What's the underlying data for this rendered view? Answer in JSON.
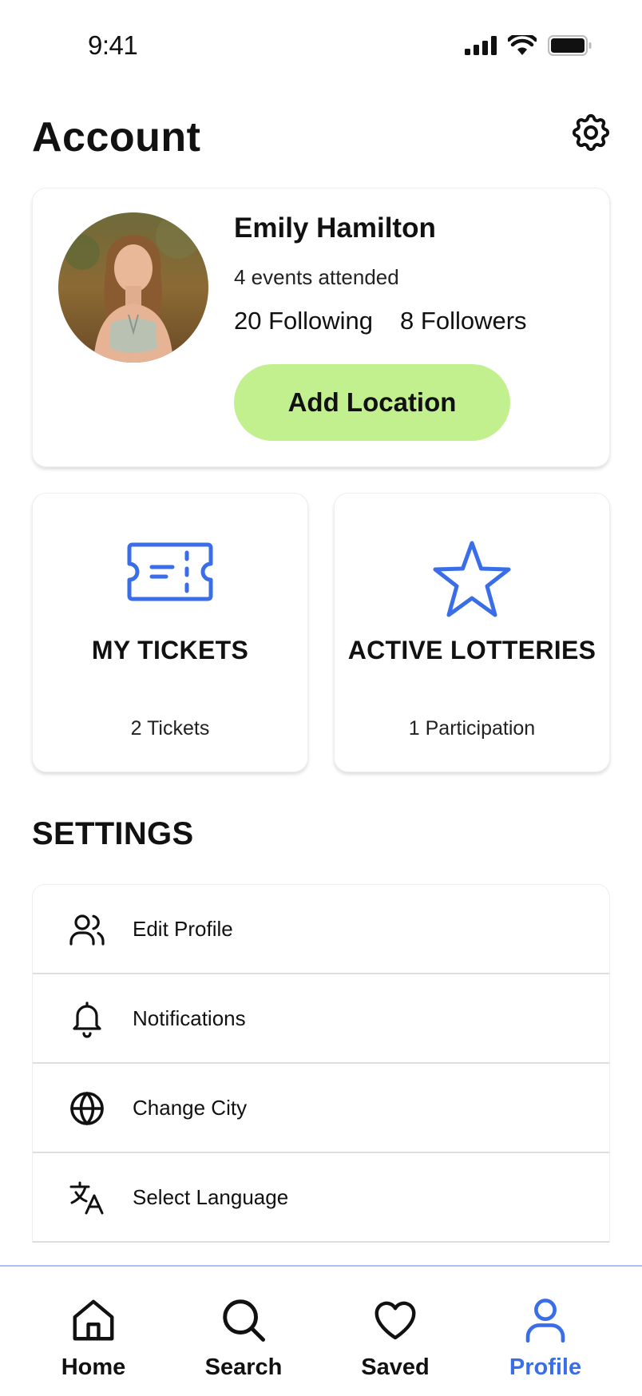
{
  "status_bar": {
    "time": "9:41"
  },
  "header": {
    "title": "Account"
  },
  "profile": {
    "name": "Emily Hamilton",
    "events_attended": "4 events attended",
    "following": "20 Following",
    "followers": "8 Followers",
    "add_location_label": "Add Location"
  },
  "tiles": [
    {
      "title": "MY TICKETS",
      "subtitle": "2 Tickets",
      "icon": "ticket-icon"
    },
    {
      "title": "ACTIVE LOTTERIES",
      "subtitle": "1 Participation",
      "icon": "star-icon"
    }
  ],
  "settings": {
    "title": "SETTINGS",
    "items": [
      {
        "label": "Edit Profile",
        "icon": "users-icon"
      },
      {
        "label": "Notifications",
        "icon": "bell-icon"
      },
      {
        "label": "Change City",
        "icon": "globe-icon"
      },
      {
        "label": "Select Language",
        "icon": "translate-icon"
      }
    ]
  },
  "tab_bar": {
    "tabs": [
      {
        "label": "Home",
        "icon": "home-icon"
      },
      {
        "label": "Search",
        "icon": "search-icon"
      },
      {
        "label": "Saved",
        "icon": "heart-icon"
      },
      {
        "label": "Profile",
        "icon": "profile-icon",
        "active": true
      }
    ]
  },
  "colors": {
    "accent": "#3a6ee8",
    "button_green": "#c3f08f",
    "text": "#111111"
  }
}
